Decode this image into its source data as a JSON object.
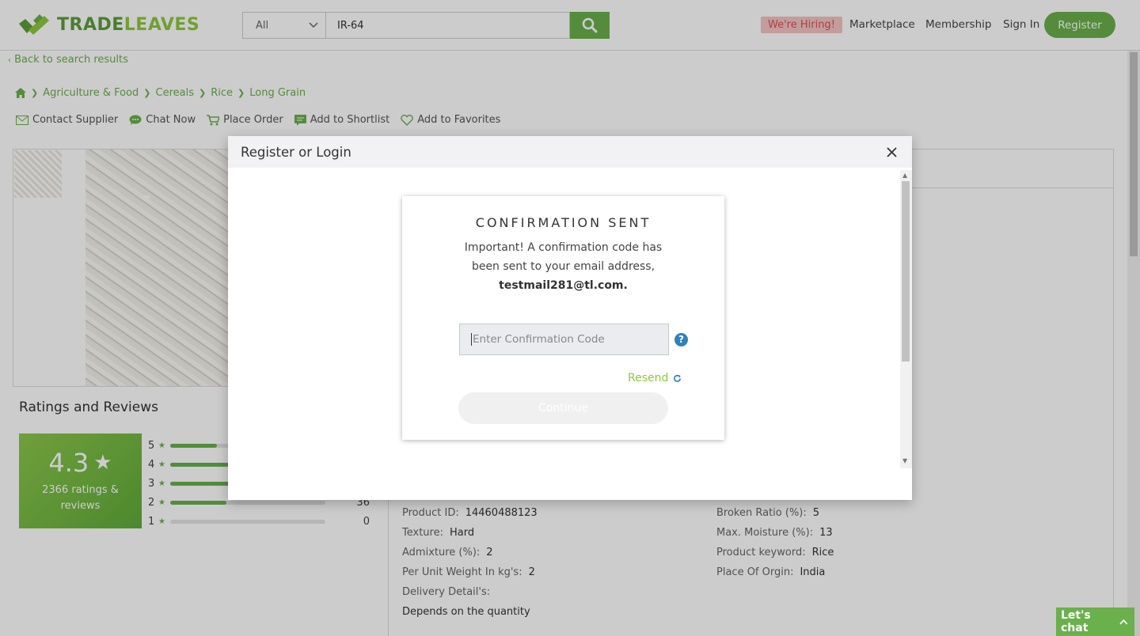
{
  "header": {
    "logo_text_1": "TRADE",
    "logo_text_2": "LEAVES",
    "search_category": "All",
    "search_value": "IR-64",
    "hiring": "We're Hiring!",
    "nav": [
      "Marketplace",
      "Membership",
      "Sign In"
    ],
    "register": "Register"
  },
  "page": {
    "back_link": "Back to search results",
    "breadcrumb": [
      "Agriculture & Food",
      "Cereals",
      "Rice",
      "Long Grain"
    ],
    "actions": [
      "Contact Supplier",
      "Chat Now",
      "Place Order",
      "Add to Shortlist",
      "Add to Favorites"
    ],
    "ratings_title": "Ratings and Reviews",
    "rating_value": "4.3",
    "rating_count": "2366 ratings & reviews",
    "rating_bars": [
      {
        "star": "5",
        "fill": 0.3,
        "count": ""
      },
      {
        "star": "4",
        "fill": 0.38,
        "count": ""
      },
      {
        "star": "3",
        "fill": 0.42,
        "count": ""
      },
      {
        "star": "2",
        "fill": 0.36,
        "count": "36"
      },
      {
        "star": "1",
        "fill": 0.0,
        "count": "0"
      }
    ],
    "specs_left": [
      {
        "k": "Product ID:",
        "v": "14460488123"
      },
      {
        "k": "Texture:",
        "v": "Hard"
      },
      {
        "k": "Admixture (%):",
        "v": "2"
      },
      {
        "k": "Per Unit Weight In kg's:",
        "v": "2"
      },
      {
        "k": "Delivery Detail's:",
        "v": ""
      },
      {
        "k": "",
        "v": "Depends on the quantity"
      }
    ],
    "specs_right": [
      {
        "k": "Broken Ratio (%):",
        "v": "5"
      },
      {
        "k": "Max. Moisture (%):",
        "v": "13"
      },
      {
        "k": "Product keyword:",
        "v": "Rice"
      },
      {
        "k": "Place Of Orgin:",
        "v": "India"
      }
    ]
  },
  "modal": {
    "title": "Register or Login",
    "card_title": "CONFIRMATION SENT",
    "message": "Important! A confirmation code has been sent to your email address,",
    "email": "testmail281@tl.com.",
    "code_placeholder": "Enter Confirmation Code",
    "resend": "Resend",
    "continue": "Continue"
  },
  "chat": {
    "label": "Let's chat"
  },
  "colors": {
    "brand_green": "#6ab04c",
    "hiring_bg": "#f4c4c4",
    "help_blue": "#2f80c0"
  }
}
